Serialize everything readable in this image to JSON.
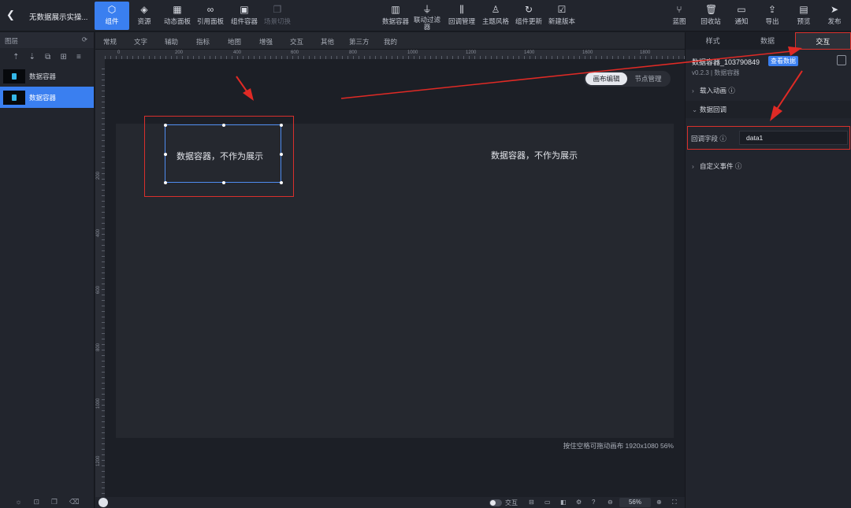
{
  "topbar": {
    "title": "无数据展示实操...",
    "left_tools": [
      {
        "label": "组件",
        "icon": "hexagon-icon",
        "active": true
      },
      {
        "label": "资源",
        "icon": "layers-icon"
      },
      {
        "label": "动态面板",
        "icon": "grid-icon"
      },
      {
        "label": "引用面板",
        "icon": "link-icon"
      },
      {
        "label": "组件容器",
        "icon": "box-icon"
      },
      {
        "label": "场景切换",
        "icon": "copy-icon",
        "disabled": true
      }
    ],
    "center_tools": [
      {
        "label": "数据容器",
        "icon": "chart-icon"
      },
      {
        "label": "联动过滤器",
        "icon": "filter-icon"
      },
      {
        "label": "回调管理",
        "icon": "sliders-icon"
      },
      {
        "label": "主题风格",
        "icon": "palette-icon"
      },
      {
        "label": "组件更新",
        "icon": "refresh-icon"
      },
      {
        "label": "新建版本",
        "icon": "checkbox-icon"
      }
    ],
    "right_tools": [
      {
        "label": "蓝图",
        "icon": "branch-icon"
      },
      {
        "label": "回收站",
        "icon": "trash-icon"
      },
      {
        "label": "通知",
        "icon": "message-icon"
      },
      {
        "label": "导出",
        "icon": "export-icon"
      },
      {
        "label": "预览",
        "icon": "preview-icon"
      },
      {
        "label": "发布",
        "icon": "send-icon"
      }
    ]
  },
  "layers": {
    "title": "图层",
    "items": [
      {
        "label": "数据容器",
        "selected": false
      },
      {
        "label": "数据容器",
        "selected": true
      }
    ]
  },
  "subbar": {
    "items": [
      "常规",
      "文字",
      "辅助",
      "指标",
      "地图",
      "增强",
      "交互",
      "其他",
      "第三方",
      "我的"
    ]
  },
  "canvas": {
    "ruler_top": [
      "0",
      "200",
      "400",
      "600",
      "800",
      "1000",
      "1200",
      "1400",
      "1600",
      "1800"
    ],
    "ruler_left": [
      "200",
      "400",
      "600",
      "800",
      "1000",
      "1200"
    ],
    "mode_tabs": [
      "画布编辑",
      "节点管理"
    ],
    "element_text": "数据容器，不作为展示",
    "hint": "按住空格可拖动画布  1920x1080 56%"
  },
  "bottombar": {
    "interact_label": "交互",
    "zoom": "56%"
  },
  "rightpanel": {
    "tabs": [
      "样式",
      "数据",
      "交互"
    ],
    "active_tab": "交互",
    "component_name": "数据容器_103790849",
    "view_data": "查看数据",
    "version": "v0.2.3 | 数据容器",
    "sections": {
      "load_anim": "载入动画",
      "data_callback": "数据回调",
      "custom_event": "自定义事件"
    },
    "callback_field_label": "回调字段",
    "callback_field_value": "data1"
  },
  "colors": {
    "accent": "#3a7ff0",
    "highlight_red": "#d9302c"
  }
}
